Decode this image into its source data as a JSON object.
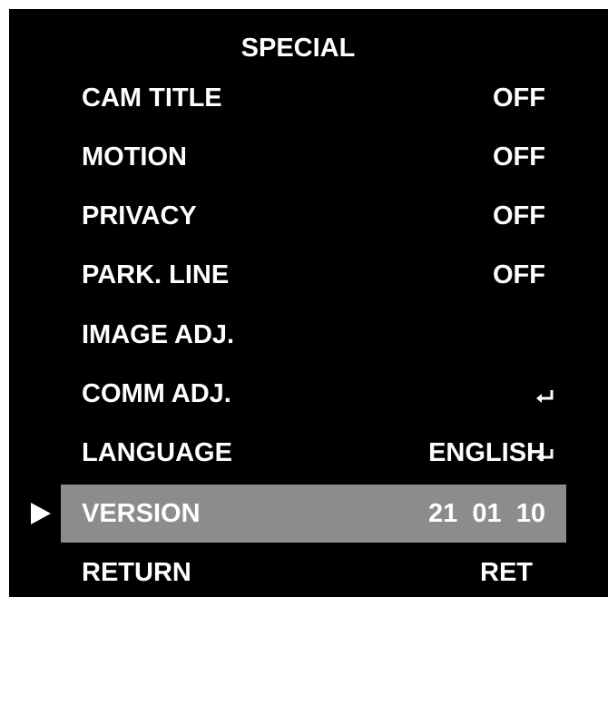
{
  "menu": {
    "title": "SPECIAL",
    "items": [
      {
        "label": "CAM TITLE",
        "value": "OFF",
        "enter_icon": false,
        "selected": false
      },
      {
        "label": "MOTION",
        "value": "OFF",
        "enter_icon": false,
        "selected": false
      },
      {
        "label": "PRIVACY",
        "value": "OFF",
        "enter_icon": false,
        "selected": false
      },
      {
        "label": "PARK. LINE",
        "value": "OFF",
        "enter_icon": false,
        "selected": false
      },
      {
        "label": "IMAGE ADJ.",
        "value": "",
        "enter_icon": true,
        "selected": false
      },
      {
        "label": "COMM ADJ.",
        "value": "",
        "enter_icon": true,
        "selected": false
      },
      {
        "label": "LANGUAGE",
        "value": "ENGLISH",
        "enter_icon": false,
        "selected": false
      },
      {
        "label": "VERSION",
        "value": "21  01  10",
        "enter_icon": false,
        "selected": true
      },
      {
        "label": "RETURN",
        "value": "RET",
        "enter_icon": true,
        "selected": false
      }
    ]
  },
  "icons": {
    "cursor": "play-arrow-icon",
    "enter": "enter-return-icon"
  },
  "colors": {
    "background": "#000000",
    "text": "#ffffff",
    "selected_row": "#8c8c8c",
    "page_border": "#ffffff"
  }
}
